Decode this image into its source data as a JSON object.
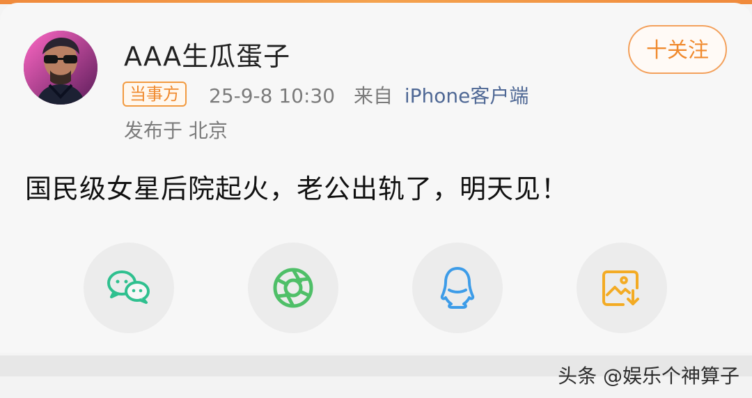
{
  "header": {
    "username": "AAA生瓜蛋子",
    "badge": "当事方",
    "time": "25-9-8 10:30",
    "source_prefix": "来自",
    "source": "iPhone客户端",
    "location": "发布于 北京",
    "follow_label": "十关注"
  },
  "post": {
    "text": "国民级女星后院起火，老公出轨了，明天见！"
  },
  "share": {
    "items": [
      {
        "icon": "wechat-icon"
      },
      {
        "icon": "moments-icon"
      },
      {
        "icon": "qq-icon"
      },
      {
        "icon": "save-image-icon"
      }
    ]
  },
  "watermark": {
    "text": "头条 @娱乐个神算子"
  },
  "colors": {
    "accent": "#f08a2e",
    "link": "#4f6895",
    "wechat": "#2fc08f",
    "moments": "#4fbf68",
    "qq": "#3d9ce8",
    "save": "#f3ab24"
  }
}
